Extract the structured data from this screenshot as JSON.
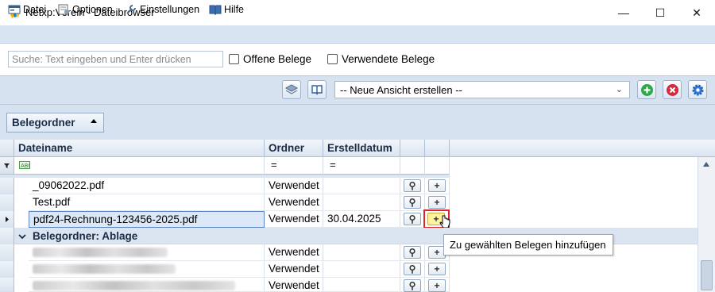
{
  "window": {
    "title": "Netxp:Verein - Dateibrowser",
    "minimize": "—",
    "maximize": "☐",
    "close": "✕"
  },
  "menu": [
    {
      "label": "Datei",
      "icon": "window-icon"
    },
    {
      "label": "Optionen",
      "icon": "options-icon"
    },
    {
      "label": "Einstellungen",
      "icon": "wrench-icon"
    },
    {
      "label": "Hilfe",
      "icon": "book-icon"
    }
  ],
  "search": {
    "placeholder": "Suche: Text eingeben und Enter drücken",
    "value": ""
  },
  "filters": {
    "open_label": "Offene Belege",
    "used_label": "Verwendete Belege"
  },
  "toolbar": {
    "view_select": "-- Neue Ansicht erstellen --"
  },
  "group_chip": {
    "label": "Belegordner"
  },
  "columns": {
    "filename": "Dateiname",
    "folder": "Ordner",
    "date": "Erstelldatum"
  },
  "filter_row": {
    "text_filter_icon": "abc-filter-icon",
    "eq1": "=",
    "eq2": "="
  },
  "rows": [
    {
      "filename": "_09062022.pdf",
      "folder": "Verwendet",
      "date": ""
    },
    {
      "filename": "Test.pdf",
      "folder": "Verwendet",
      "date": ""
    },
    {
      "filename": "pdf24-Rechnung-123456-2025.pdf",
      "folder": "Verwendet",
      "date": "30.04.2025"
    }
  ],
  "group_header": {
    "label": "Belegordner: Ablage"
  },
  "blurred_rows": [
    {
      "folder": "Verwendet"
    },
    {
      "folder": "Verwendet"
    },
    {
      "folder": "Verwendet"
    }
  ],
  "buttons": {
    "search_glyph": "⚲",
    "add_glyph": "+"
  },
  "tooltip": {
    "text": "Zu gewählten Belegen hinzufügen"
  },
  "colors": {
    "accent": "#2f6fbf",
    "highlight_red": "#d9262c",
    "highlight_yellow": "#fff3a3",
    "green": "#28a745",
    "red": "#d7263d",
    "blue": "#3d7edb"
  }
}
